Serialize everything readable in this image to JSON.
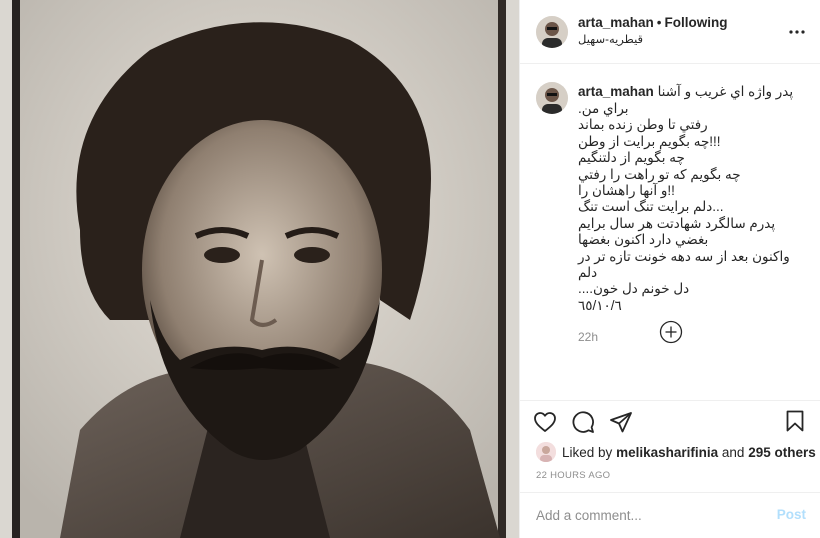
{
  "header": {
    "username": "arta_mahan",
    "separator": "•",
    "follow_status": "Following",
    "location": "قیطریه-سهیل",
    "more_icon": "more-horizontal-icon"
  },
  "caption": {
    "username": "arta_mahan",
    "first_line": "پدر واژه اي غريب و آشنا",
    "lines": [
      "براي من.",
      "رفتي تا وطن زنده بماند",
      "!!!چه بگويم برايت از وطن",
      "چه بگويم از دلتنگيم",
      "چه بگويم كه تو راهت را رفتي",
      "!!و آنها راهشان را",
      "...دلم برايت تنگ است تنگ",
      "پدرم سالگرد شهادتت هر سال برايم",
      "بغضي دارد اكنون بغضها",
      "واكنون بعد از سه دهه خونت تازه تر در",
      "دلم",
      "دل خونم دل خون....",
      "٦٥/١٠/٦"
    ],
    "time": "22h"
  },
  "actions": {
    "like_icon": "heart-icon",
    "comment_icon": "comment-icon",
    "share_icon": "share-icon",
    "save_icon": "bookmark-icon",
    "liked_by_prefix": "Liked by",
    "liked_by_user": "melikasharifinia",
    "and": "and",
    "others": "295 others",
    "posted_ago": "22 HOURS AGO"
  },
  "comment_box": {
    "placeholder": "Add a comment...",
    "post_label": "Post"
  },
  "colors": {
    "link_disabled": "#b2dffc",
    "secondary_text": "#8e8e8e",
    "border": "#efefef"
  }
}
